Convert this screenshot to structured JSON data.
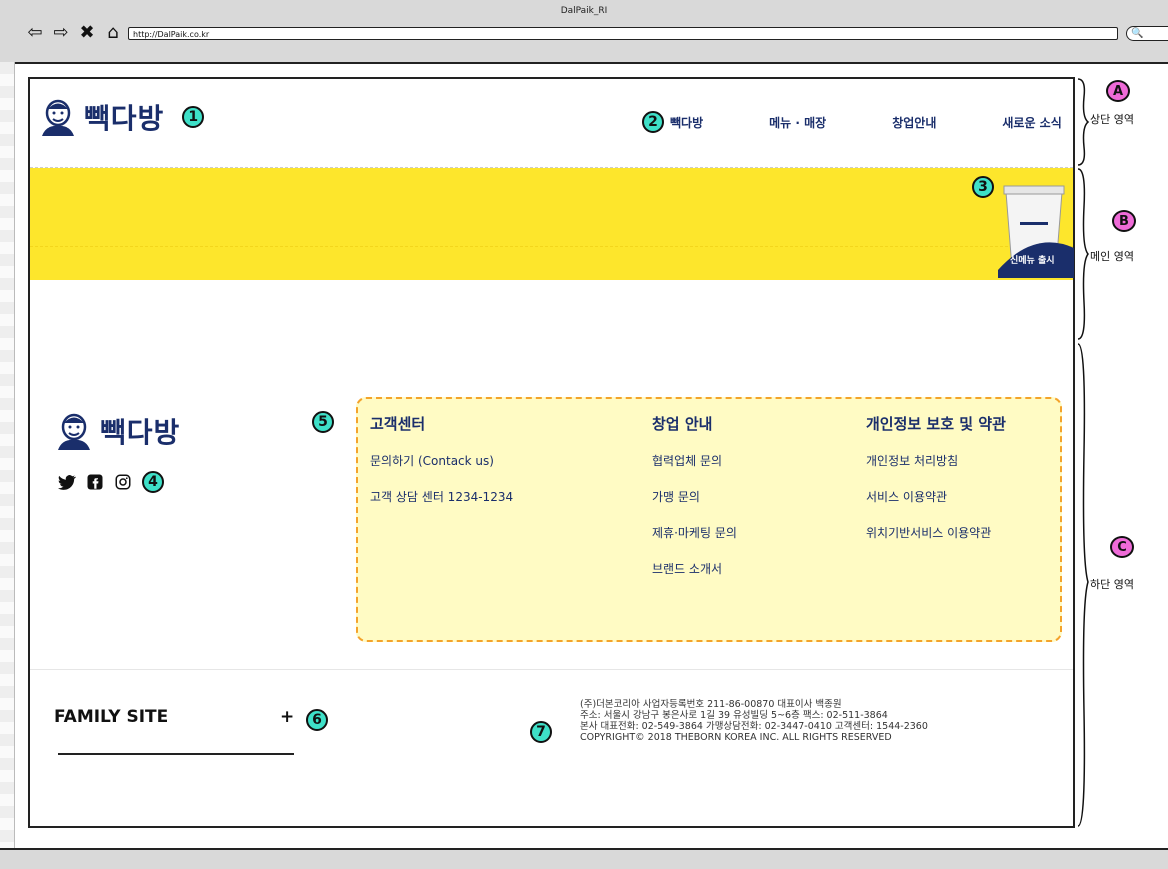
{
  "browser": {
    "window_title": "DalPaik_RI",
    "nav_icons": [
      "back-arrow-icon",
      "forward-arrow-icon",
      "stop-icon",
      "home-icon"
    ],
    "url": "http://DalPaik.co.kr",
    "search_glyph": "🔍"
  },
  "header": {
    "logo_text": "빽다방",
    "marker": "1",
    "gnb_marker": "2",
    "nav": [
      {
        "label": "빽다방"
      },
      {
        "label": "메뉴 · 매장"
      },
      {
        "label": "창업안내"
      },
      {
        "label": "새로운 소식"
      }
    ]
  },
  "main": {
    "marker": "3",
    "band_color": "#fde62c",
    "promo_badge": "신메뉴 출시"
  },
  "footer": {
    "logo_text": "빽다방",
    "social_marker": "4",
    "social": [
      "twitter-icon",
      "facebook-icon",
      "instagram-icon"
    ],
    "box_marker": "5",
    "columns": [
      {
        "title": "고객센터",
        "links": [
          "문의하기 (Contack us)",
          "고객 상담 센터 1234-1234"
        ]
      },
      {
        "title": "창업 안내",
        "links": [
          "협력업체 문의",
          "가맹 문의",
          "제휴·마케팅 문의",
          "브랜드 소개서"
        ]
      },
      {
        "title": "개인정보 보호 및 약관",
        "links": [
          "개인정보 처리방침",
          "서비스 이용약관",
          "위치기반서비스 이용약관"
        ]
      }
    ],
    "family": {
      "label": "FAMILY SITE",
      "plus": "+",
      "marker": "6"
    },
    "company_marker": "7",
    "company_lines": [
      "(주)더본코리아 사업자등록번호 211-86-00870 대표이사 백종원",
      "주소: 서울시 강남구 봉은사로 1길 39 유성빌딩 5~6층 팩스: 02-511-3864",
      "본사 대표전화: 02-549-3864 가맹상담전화: 02-3447-0410 고객센터: 1544-2360",
      "COPYRIGHT© 2018 THEBORN KOREA INC. ALL RIGHTS RESERVED"
    ]
  },
  "annotations": [
    {
      "marker": "A",
      "label": "상단 영역"
    },
    {
      "marker": "B",
      "label": "메인 영역"
    },
    {
      "marker": "C",
      "label": "하단 영역"
    }
  ],
  "colors": {
    "brand_navy": "#1a2e6b",
    "marker_teal": "#3ee0c8",
    "marker_pink": "#ef6bd8",
    "info_box_bg": "#fffbc4",
    "info_box_border": "#f4a32a"
  }
}
